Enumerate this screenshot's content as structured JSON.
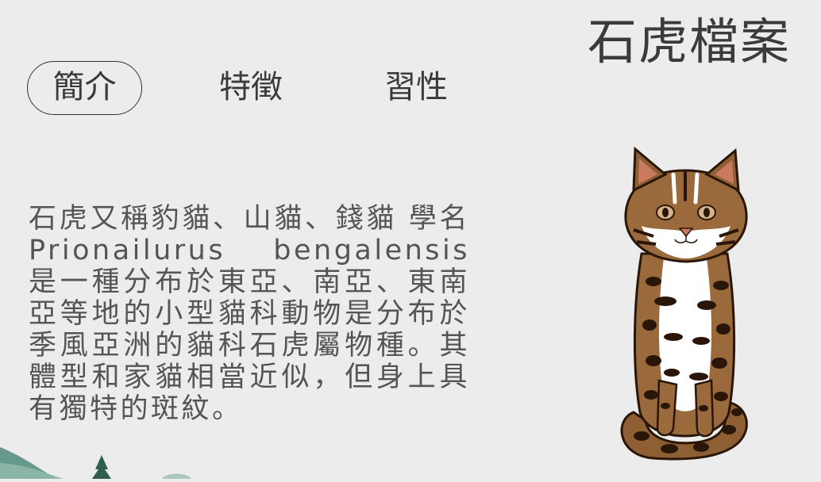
{
  "page": {
    "title": "石虎檔案"
  },
  "tabs": [
    {
      "label": "簡介",
      "active": true
    },
    {
      "label": "特徵",
      "active": false
    },
    {
      "label": "習性",
      "active": false
    }
  ],
  "content": {
    "description": "石虎又稱豹貓、山貓、錢貓 學名 Prionailurus bengalensis 是一種分布於東亞、南亞、東南亞等地的小型貓科動物是分布於季風亞洲的貓科石虎屬物種。其體型和家貓相當近似，但身上具有獨特的斑紋。"
  },
  "illustration": {
    "icon": "leopard-cat-illustration",
    "colors": {
      "fur": "#9a6a3c",
      "fur_dark": "#6e4622",
      "spots": "#2a1608",
      "belly": "#ffffff",
      "ear_inner": "#c97a60"
    }
  },
  "decoration": {
    "icon": "ink-landscape-decoration",
    "colors": {
      "mountain": "#4f8a7a",
      "tree": "#2f5d50"
    }
  }
}
